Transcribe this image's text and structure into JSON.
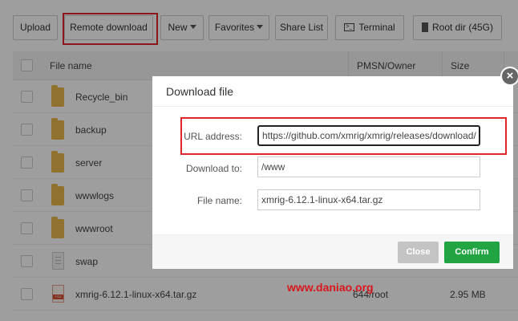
{
  "toolbar": {
    "upload": "Upload",
    "remote_download": "Remote download",
    "new": "New",
    "favorites": "Favorites",
    "share_list": "Share List",
    "terminal": "Terminal",
    "root_dir": "Root dir (45G)"
  },
  "table": {
    "headers": {
      "name": "File name",
      "owner": "PMSN/Owner",
      "size": "Size"
    },
    "rows": [
      {
        "name": "Recycle_bin",
        "type": "folder"
      },
      {
        "name": "backup",
        "type": "folder"
      },
      {
        "name": "server",
        "type": "folder"
      },
      {
        "name": "wwwlogs",
        "type": "folder"
      },
      {
        "name": "wwwroot",
        "type": "folder"
      },
      {
        "name": "swap",
        "type": "file"
      },
      {
        "name": "xmrig-6.12.1-linux-x64.tar.gz",
        "type": "archive",
        "owner": "644/root",
        "size": "2.95 MB"
      }
    ]
  },
  "modal": {
    "title": "Download file",
    "url_label": "URL address:",
    "url_value": "https://github.com/xmrig/xmrig/releases/download/",
    "dir_label": "Download to:",
    "dir_value": "/www",
    "filename_label": "File name:",
    "filename_value": "xmrig-6.12.1-linux-x64.tar.gz",
    "close_button": "Close",
    "confirm_button": "Confirm",
    "close_icon": "×"
  },
  "watermark": "www.daniao.org",
  "colors": {
    "highlight_red": "#e0262b",
    "confirm_green": "#23a443",
    "close_gray": "#c4c4c4",
    "folder_yellow": "#e8b64a",
    "watermark_red": "#d8171d"
  }
}
